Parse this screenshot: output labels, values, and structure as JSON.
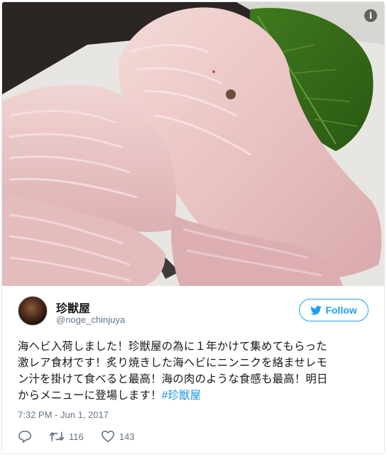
{
  "tweet": {
    "display_name": "珍獣屋",
    "handle": "@noge_chinjuya",
    "follow_label": "Follow",
    "text_line1": "海ヘビ入荷しました！珍獣屋の為に１年かけて集めてもらった",
    "text_line2": "激レア食材です！炙り焼きした海ヘビにニンニクを絡ませレモ",
    "text_line3": "ン汁を掛けて食べると最高！海の肉のような食感も最高！明日",
    "text_line4_prefix": "からメニューに登場します！",
    "hashtag": "#珍獣屋",
    "timestamp": "7:32 PM - Jun 1, 2017",
    "retweet_count": "116",
    "like_count": "143"
  },
  "icons": {
    "info": "info-icon",
    "follow": "twitter-bird-icon",
    "reply": "reply-icon",
    "retweet": "retweet-icon",
    "like": "heart-icon"
  },
  "colors": {
    "accent": "#1da1f2",
    "hashtag": "#1b95e0",
    "secondary_text": "#657786",
    "border": "#e1e8ed"
  }
}
